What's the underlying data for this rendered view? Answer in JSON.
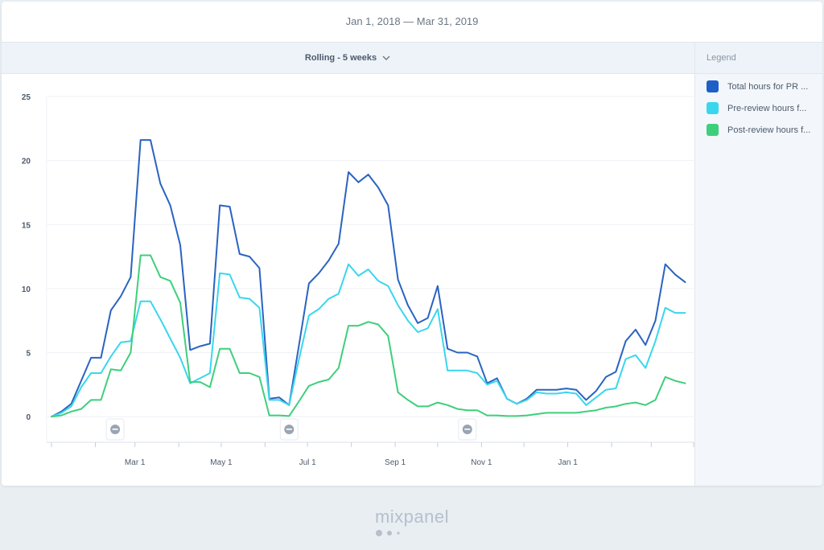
{
  "header": {
    "date_range": "Jan 1, 2018 — Mar 31, 2019"
  },
  "toolbar": {
    "rolling_label": "Rolling - 5 weeks"
  },
  "legend": {
    "title": "Legend",
    "items": [
      {
        "label": "Total hours for PR ...",
        "color": "#1f5fc8"
      },
      {
        "label": "Pre-review hours f...",
        "color": "#3ad6ee"
      },
      {
        "label": "Post-review hours f...",
        "color": "#3ecf7b"
      }
    ]
  },
  "footer": {
    "brand": "mixpanel"
  },
  "chart_data": {
    "type": "line",
    "x_ticks": [
      "Mar 1",
      "May 1",
      "Jul 1",
      "Sep 1",
      "Nov 1",
      "Jan 1"
    ],
    "y_ticks": [
      0,
      5,
      10,
      15,
      20,
      25
    ],
    "ylim": [
      -2,
      25
    ],
    "xlim": [
      "2018-01-01",
      "2019-03-31"
    ],
    "grid": true,
    "legend_position": "right",
    "annotation_markers": [
      "2018-02-15",
      "2018-06-18",
      "2018-10-22"
    ],
    "series": [
      {
        "name": "Total hours for PR ...",
        "color": "#2a63c0",
        "points": [
          [
            "2018-01-01",
            0
          ],
          [
            "2018-01-08",
            0.4
          ],
          [
            "2018-01-15",
            1.0
          ],
          [
            "2018-01-22",
            2.8
          ],
          [
            "2018-01-29",
            4.6
          ],
          [
            "2018-02-05",
            4.6
          ],
          [
            "2018-02-12",
            8.3
          ],
          [
            "2018-02-19",
            9.4
          ],
          [
            "2018-02-26",
            10.9
          ],
          [
            "2018-03-05",
            21.6
          ],
          [
            "2018-03-12",
            21.6
          ],
          [
            "2018-03-19",
            18.2
          ],
          [
            "2018-03-26",
            16.5
          ],
          [
            "2018-04-02",
            13.4
          ],
          [
            "2018-04-09",
            5.2
          ],
          [
            "2018-04-16",
            5.5
          ],
          [
            "2018-04-23",
            5.7
          ],
          [
            "2018-04-30",
            16.5
          ],
          [
            "2018-05-07",
            16.4
          ],
          [
            "2018-05-14",
            12.7
          ],
          [
            "2018-05-21",
            12.5
          ],
          [
            "2018-05-28",
            11.6
          ],
          [
            "2018-06-04",
            1.4
          ],
          [
            "2018-06-11",
            1.5
          ],
          [
            "2018-06-18",
            0.9
          ],
          [
            "2018-06-25",
            5.6
          ],
          [
            "2018-07-02",
            10.4
          ],
          [
            "2018-07-09",
            11.2
          ],
          [
            "2018-07-16",
            12.2
          ],
          [
            "2018-07-23",
            13.5
          ],
          [
            "2018-07-30",
            19.1
          ],
          [
            "2018-08-06",
            18.3
          ],
          [
            "2018-08-13",
            18.9
          ],
          [
            "2018-08-20",
            17.9
          ],
          [
            "2018-08-27",
            16.5
          ],
          [
            "2018-09-03",
            10.7
          ],
          [
            "2018-09-10",
            8.7
          ],
          [
            "2018-09-17",
            7.3
          ],
          [
            "2018-09-24",
            7.7
          ],
          [
            "2018-10-01",
            10.2
          ],
          [
            "2018-10-08",
            5.3
          ],
          [
            "2018-10-15",
            5.0
          ],
          [
            "2018-10-22",
            5.0
          ],
          [
            "2018-10-29",
            4.7
          ],
          [
            "2018-11-05",
            2.6
          ],
          [
            "2018-11-12",
            3.0
          ],
          [
            "2018-11-19",
            1.4
          ],
          [
            "2018-11-26",
            1.0
          ],
          [
            "2018-12-03",
            1.4
          ],
          [
            "2018-12-10",
            2.1
          ],
          [
            "2018-12-17",
            2.1
          ],
          [
            "2018-12-24",
            2.1
          ],
          [
            "2018-12-31",
            2.2
          ],
          [
            "2019-01-07",
            2.1
          ],
          [
            "2019-01-14",
            1.3
          ],
          [
            "2019-01-21",
            2.0
          ],
          [
            "2019-01-28",
            3.1
          ],
          [
            "2019-02-04",
            3.5
          ],
          [
            "2019-02-11",
            5.9
          ],
          [
            "2019-02-18",
            6.8
          ],
          [
            "2019-02-25",
            5.6
          ],
          [
            "2019-03-04",
            7.5
          ],
          [
            "2019-03-11",
            11.9
          ],
          [
            "2019-03-18",
            11.1
          ],
          [
            "2019-03-25",
            10.5
          ]
        ]
      },
      {
        "name": "Pre-review hours f...",
        "color": "#3ad6ee",
        "points": [
          [
            "2018-01-01",
            0
          ],
          [
            "2018-01-08",
            0.3
          ],
          [
            "2018-01-15",
            0.8
          ],
          [
            "2018-01-22",
            2.3
          ],
          [
            "2018-01-29",
            3.4
          ],
          [
            "2018-02-05",
            3.4
          ],
          [
            "2018-02-12",
            4.7
          ],
          [
            "2018-02-19",
            5.8
          ],
          [
            "2018-02-26",
            5.9
          ],
          [
            "2018-03-05",
            9.0
          ],
          [
            "2018-03-12",
            9.0
          ],
          [
            "2018-03-19",
            7.6
          ],
          [
            "2018-03-26",
            6.1
          ],
          [
            "2018-04-02",
            4.6
          ],
          [
            "2018-04-09",
            2.6
          ],
          [
            "2018-04-16",
            3.0
          ],
          [
            "2018-04-23",
            3.4
          ],
          [
            "2018-04-30",
            11.2
          ],
          [
            "2018-05-07",
            11.1
          ],
          [
            "2018-05-14",
            9.3
          ],
          [
            "2018-05-21",
            9.2
          ],
          [
            "2018-05-28",
            8.5
          ],
          [
            "2018-06-04",
            1.3
          ],
          [
            "2018-06-11",
            1.3
          ],
          [
            "2018-06-18",
            0.9
          ],
          [
            "2018-06-25",
            4.5
          ],
          [
            "2018-07-02",
            7.9
          ],
          [
            "2018-07-09",
            8.4
          ],
          [
            "2018-07-16",
            9.2
          ],
          [
            "2018-07-23",
            9.6
          ],
          [
            "2018-07-30",
            11.9
          ],
          [
            "2018-08-06",
            11.0
          ],
          [
            "2018-08-13",
            11.5
          ],
          [
            "2018-08-20",
            10.6
          ],
          [
            "2018-08-27",
            10.2
          ],
          [
            "2018-09-03",
            8.7
          ],
          [
            "2018-09-10",
            7.5
          ],
          [
            "2018-09-17",
            6.6
          ],
          [
            "2018-09-24",
            6.9
          ],
          [
            "2018-10-01",
            8.4
          ],
          [
            "2018-10-08",
            3.6
          ],
          [
            "2018-10-15",
            3.6
          ],
          [
            "2018-10-22",
            3.6
          ],
          [
            "2018-10-29",
            3.4
          ],
          [
            "2018-11-05",
            2.5
          ],
          [
            "2018-11-12",
            2.8
          ],
          [
            "2018-11-19",
            1.4
          ],
          [
            "2018-11-26",
            1.0
          ],
          [
            "2018-12-03",
            1.3
          ],
          [
            "2018-12-10",
            1.9
          ],
          [
            "2018-12-17",
            1.8
          ],
          [
            "2018-12-24",
            1.8
          ],
          [
            "2018-12-31",
            1.9
          ],
          [
            "2019-01-07",
            1.8
          ],
          [
            "2019-01-14",
            0.9
          ],
          [
            "2019-01-21",
            1.5
          ],
          [
            "2019-01-28",
            2.1
          ],
          [
            "2019-02-04",
            2.2
          ],
          [
            "2019-02-11",
            4.5
          ],
          [
            "2019-02-18",
            4.8
          ],
          [
            "2019-02-25",
            3.8
          ],
          [
            "2019-03-04",
            5.9
          ],
          [
            "2019-03-11",
            8.5
          ],
          [
            "2019-03-18",
            8.1
          ],
          [
            "2019-03-25",
            8.1
          ]
        ]
      },
      {
        "name": "Post-review hours f...",
        "color": "#3ecf7b",
        "points": [
          [
            "2018-01-01",
            0
          ],
          [
            "2018-01-08",
            0.1
          ],
          [
            "2018-01-15",
            0.4
          ],
          [
            "2018-01-22",
            0.6
          ],
          [
            "2018-01-29",
            1.3
          ],
          [
            "2018-02-05",
            1.3
          ],
          [
            "2018-02-12",
            3.7
          ],
          [
            "2018-02-19",
            3.6
          ],
          [
            "2018-02-26",
            5.0
          ],
          [
            "2018-03-05",
            12.6
          ],
          [
            "2018-03-12",
            12.6
          ],
          [
            "2018-03-19",
            10.9
          ],
          [
            "2018-03-26",
            10.6
          ],
          [
            "2018-04-02",
            8.9
          ],
          [
            "2018-04-09",
            2.7
          ],
          [
            "2018-04-16",
            2.7
          ],
          [
            "2018-04-23",
            2.3
          ],
          [
            "2018-04-30",
            5.3
          ],
          [
            "2018-05-07",
            5.3
          ],
          [
            "2018-05-14",
            3.4
          ],
          [
            "2018-05-21",
            3.4
          ],
          [
            "2018-05-28",
            3.1
          ],
          [
            "2018-06-04",
            0.1
          ],
          [
            "2018-06-11",
            0.1
          ],
          [
            "2018-06-18",
            0.05
          ],
          [
            "2018-06-25",
            1.2
          ],
          [
            "2018-07-02",
            2.4
          ],
          [
            "2018-07-09",
            2.7
          ],
          [
            "2018-07-16",
            2.9
          ],
          [
            "2018-07-23",
            3.8
          ],
          [
            "2018-07-30",
            7.1
          ],
          [
            "2018-08-06",
            7.1
          ],
          [
            "2018-08-13",
            7.4
          ],
          [
            "2018-08-20",
            7.2
          ],
          [
            "2018-08-27",
            6.3
          ],
          [
            "2018-09-03",
            1.9
          ],
          [
            "2018-09-10",
            1.3
          ],
          [
            "2018-09-17",
            0.8
          ],
          [
            "2018-09-24",
            0.8
          ],
          [
            "2018-10-01",
            1.1
          ],
          [
            "2018-10-08",
            0.9
          ],
          [
            "2018-10-15",
            0.6
          ],
          [
            "2018-10-22",
            0.5
          ],
          [
            "2018-10-29",
            0.5
          ],
          [
            "2018-11-05",
            0.1
          ],
          [
            "2018-11-12",
            0.1
          ],
          [
            "2018-11-19",
            0.05
          ],
          [
            "2018-11-26",
            0.05
          ],
          [
            "2018-12-03",
            0.1
          ],
          [
            "2018-12-10",
            0.2
          ],
          [
            "2018-12-17",
            0.3
          ],
          [
            "2018-12-24",
            0.3
          ],
          [
            "2018-12-31",
            0.3
          ],
          [
            "2019-01-07",
            0.3
          ],
          [
            "2019-01-14",
            0.4
          ],
          [
            "2019-01-21",
            0.5
          ],
          [
            "2019-01-28",
            0.7
          ],
          [
            "2019-02-04",
            0.8
          ],
          [
            "2019-02-11",
            1.0
          ],
          [
            "2019-02-18",
            1.1
          ],
          [
            "2019-02-25",
            0.9
          ],
          [
            "2019-03-04",
            1.3
          ],
          [
            "2019-03-11",
            3.1
          ],
          [
            "2019-03-18",
            2.8
          ],
          [
            "2019-03-25",
            2.6
          ]
        ]
      }
    ]
  }
}
